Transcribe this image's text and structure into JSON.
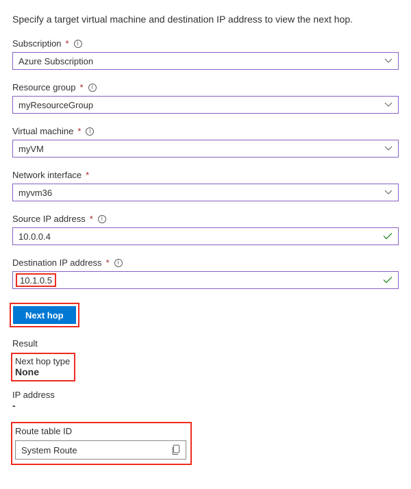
{
  "intro": "Specify a target virtual machine and destination IP address to view the next hop.",
  "fields": {
    "subscription": {
      "label": "Subscription",
      "value": "Azure Subscription"
    },
    "resource_group": {
      "label": "Resource group",
      "value": "myResourceGroup"
    },
    "virtual_machine": {
      "label": "Virtual machine",
      "value": "myVM"
    },
    "network_interface": {
      "label": "Network interface",
      "value": "myvm36"
    },
    "source_ip": {
      "label": "Source IP address",
      "value": "10.0.0.4"
    },
    "destination_ip": {
      "label": "Destination IP address",
      "value": "10.1.0.5"
    }
  },
  "button": {
    "next_hop": "Next hop"
  },
  "result": {
    "heading": "Result",
    "next_hop_type_label": "Next hop type",
    "next_hop_type_value": "None",
    "ip_label": "IP address",
    "ip_value": "-",
    "route_table_label": "Route table ID",
    "route_table_value": "System Route"
  }
}
